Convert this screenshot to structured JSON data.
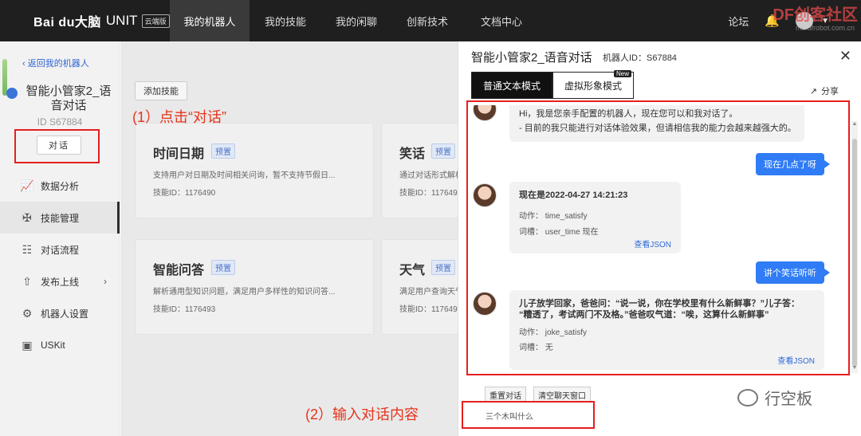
{
  "topnav": {
    "brand": "Bai du大脑",
    "unit": "UNIT",
    "edition": "云端版",
    "items": [
      "我的机器人",
      "我的技能",
      "我的闲聊",
      "创新技术",
      "文档中心"
    ],
    "forum": "论坛",
    "watermark": "DF创客社区",
    "watermark_sub": "mc.dfrobot.com.cn"
  },
  "sidebar": {
    "back": "返回我的机器人",
    "robot_name": "智能小管家2_语音对话",
    "robot_id": "ID S67884",
    "dialog_btn": "对话",
    "menu": [
      {
        "label": "数据分析",
        "icon": "chart-icon"
      },
      {
        "label": "技能管理",
        "icon": "skills-icon"
      },
      {
        "label": "对话流程",
        "icon": "flow-icon"
      },
      {
        "label": "发布上线",
        "icon": "publish-icon"
      },
      {
        "label": "机器人设置",
        "icon": "gear-icon"
      },
      {
        "label": "USKit",
        "icon": "uskit-icon"
      }
    ]
  },
  "main": {
    "add_skill": "添加技能",
    "cards": [
      {
        "title": "时间日期",
        "tag": "预置",
        "desc": "支持用户对日期及时间相关问询，暂不支持节假日...",
        "sid": "技能ID：1176490"
      },
      {
        "title": "笑话",
        "tag": "预置",
        "desc": "通过对话形式解析",
        "sid": "技能ID：117649"
      },
      {
        "title": "智能问答",
        "tag": "预置",
        "desc": "解析通用型知识问题，满足用户多样性的知识问答...",
        "sid": "技能ID：1176493"
      },
      {
        "title": "天气",
        "tag": "预置",
        "desc": "满足用户查询天气",
        "sid": "技能ID：117649"
      }
    ]
  },
  "annotations": {
    "step1": "(1）点击“对话”",
    "step2": "(2）输入对话内容"
  },
  "panel": {
    "title": "智能小管家2_语音对话",
    "robot_id": "机器人ID：S67884",
    "tab_text": "普通文本模式",
    "tab_avatar": "虚拟形象模式",
    "new_badge": "New",
    "share": "分享",
    "chat": {
      "bot1_line1": "Hi，我是您亲手配置的机器人，现在您可以和我对话了。",
      "bot1_line2": "- 目前的我只能进行对话体验效果，但请相信我的能力会越来越强大的。",
      "user1": "现在几点了呀",
      "bot2_title": "现在是2022-04-27 14:21:23",
      "bot2_action_label": "动作：",
      "bot2_action": "time_satisfy",
      "bot2_slot_label": "词槽：",
      "bot2_slot": "user_time 现在",
      "json_link": "查看JSON",
      "user2": "讲个笑话听听",
      "bot3_line1": "儿子放学回家，爸爸问：“说一说，你在学校里有什么新鲜事？”儿子答：",
      "bot3_line2": "“糟透了，考试两门不及格。”爸爸叹气道：“唉，这算什么新鲜事”",
      "bot3_action_label": "动作：",
      "bot3_action": "joke_satisfy",
      "bot3_slot_label": "词槽：",
      "bot3_slot": "无"
    },
    "reset_btn": "重置对话",
    "clear_btn": "清空聊天窗口",
    "input_value": "三个木叫什么",
    "watermark": "行空板"
  }
}
